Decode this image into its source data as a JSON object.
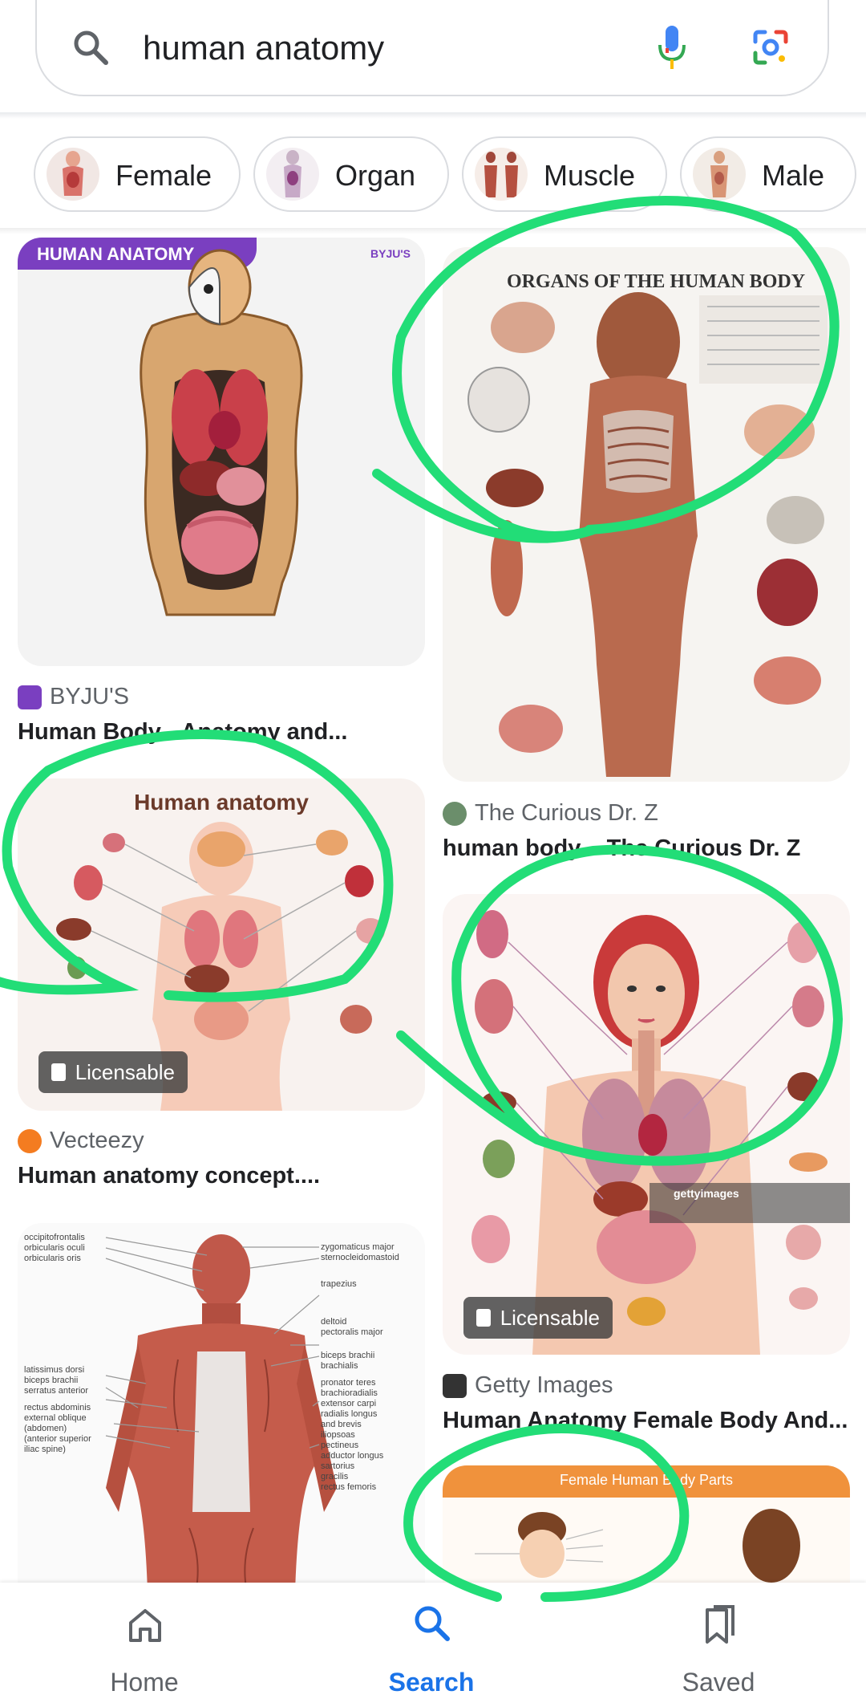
{
  "search": {
    "query": "human anatomy"
  },
  "chips": [
    {
      "label": "Female"
    },
    {
      "label": "Organ"
    },
    {
      "label": "Muscle"
    },
    {
      "label": "Male"
    }
  ],
  "results": [
    {
      "source": "BYJU'S",
      "title": "Human Body - Anatomy and...",
      "banner": "HUMAN ANATOMY",
      "logo": "BYJU'S"
    },
    {
      "source": "The Curious Dr. Z",
      "title": "human body – The Curious Dr. Z",
      "heading": "ORGANS OF THE HUMAN BODY"
    },
    {
      "source": "Vecteezy",
      "title": "Human anatomy concept....",
      "heading": "Human anatomy",
      "badge": "Licensable"
    },
    {
      "source": "Getty Images",
      "title": "Human Anatomy Female Body And...",
      "badge": "Licensable",
      "watermark": "gettyimages"
    },
    {
      "heading": "Female Human Body Parts"
    }
  ],
  "muscle_labels_left": [
    "occipitofrontalis",
    "orbicularis oculi",
    "orbicularis oris",
    "latissimus dorsi",
    "biceps brachii",
    "serratus anterior",
    "rectus abdominis",
    "external oblique",
    "(abdomen)",
    "(anterior superior",
    "iliac spine)"
  ],
  "muscle_labels_right": [
    "zygomaticus major",
    "sternocleidomastoid",
    "trapezius",
    "deltoid",
    "pectoralis major",
    "biceps brachii",
    "brachialis",
    "pronator teres",
    "brachioradialis",
    "extensor carpi",
    "radialis longus",
    "and brevis",
    "iliopsoas",
    "pectineus",
    "adductor longus",
    "sartorius",
    "gracilis",
    "rectus femoris"
  ],
  "nav": [
    {
      "label": "Home",
      "icon": "home-icon"
    },
    {
      "label": "Search",
      "icon": "search-icon"
    },
    {
      "label": "Saved",
      "icon": "bookmark-icon"
    }
  ],
  "colors": {
    "accent": "#1a73e8",
    "annotation": "#22dd77",
    "banner": "#7a3fc0"
  }
}
